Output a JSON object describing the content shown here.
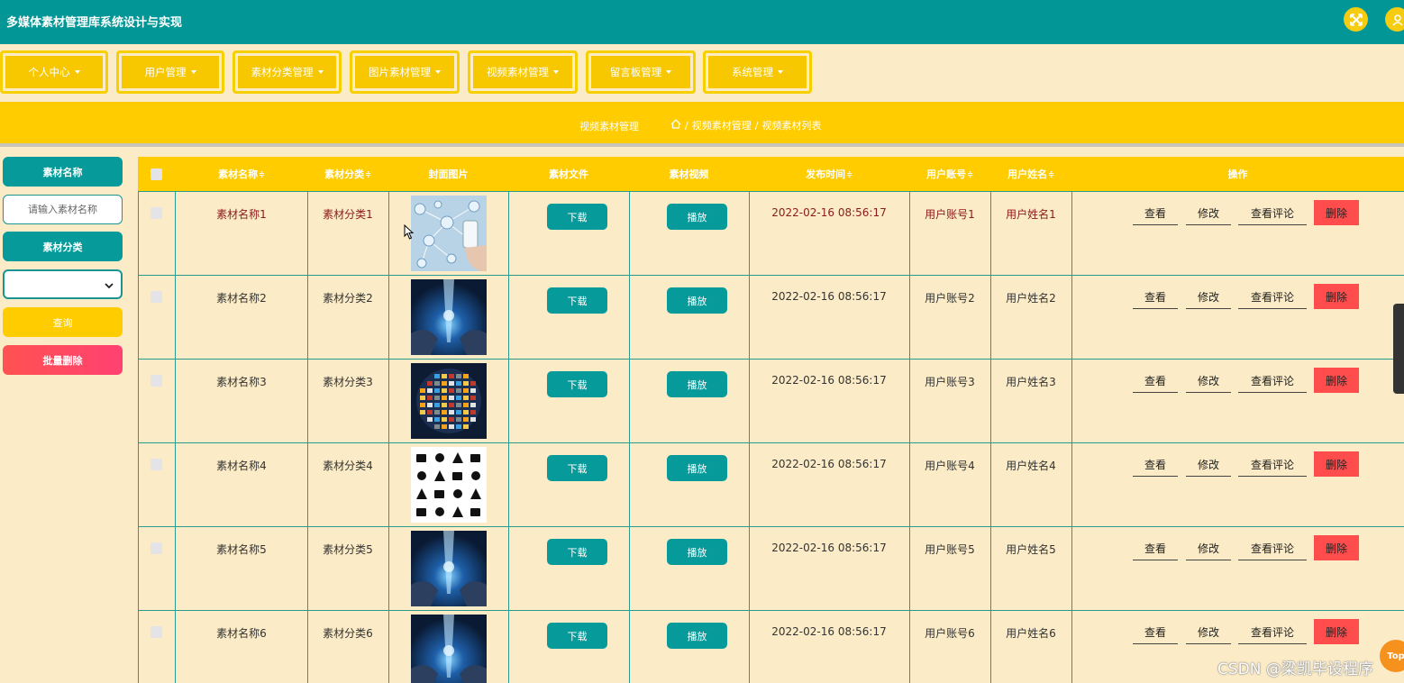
{
  "header": {
    "title": "多媒体素材管理库系统设计与实现",
    "fullscreen_icon": "fullscreen-icon",
    "user_icon": "user-icon"
  },
  "nav": {
    "items": [
      {
        "label": "个人中心"
      },
      {
        "label": "用户管理"
      },
      {
        "label": "素材分类管理"
      },
      {
        "label": "图片素材管理"
      },
      {
        "label": "视频素材管理"
      },
      {
        "label": "留言板管理"
      },
      {
        "label": "系统管理"
      }
    ]
  },
  "breadcrumb": {
    "page_title": "视频素材管理",
    "home_icon": "home-icon",
    "path_1": "视频素材管理",
    "path_2": "视频素材列表",
    "separator": "/"
  },
  "sidebar": {
    "name_label": "素材名称",
    "name_placeholder": "请输入素材名称",
    "category_label": "素材分类",
    "category_value": "",
    "query_button": "查询",
    "batch_delete_button": "批量删除"
  },
  "table": {
    "headers": {
      "name": "素材名称",
      "category": "素材分类",
      "cover": "封面图片",
      "file": "素材文件",
      "video": "素材视频",
      "published": "发布时间",
      "account": "用户账号",
      "username": "用户姓名",
      "actions": "操作"
    },
    "sort_glyph": "≑",
    "rows": [
      {
        "name": "素材名称1",
        "category": "素材分类1",
        "cover": "network-hand-phone",
        "download": "下载",
        "play": "播放",
        "published": "2022-02-16 08:56:17",
        "account": "用户账号1",
        "username": "用户姓名1",
        "view": "查看",
        "edit": "修改",
        "comments": "查看评论",
        "delete": "删除"
      },
      {
        "name": "素材名称2",
        "category": "素材分类2",
        "cover": "digital-hands",
        "download": "下载",
        "play": "播放",
        "published": "2022-02-16 08:56:17",
        "account": "用户账号2",
        "username": "用户姓名2",
        "view": "查看",
        "edit": "修改",
        "comments": "查看评论",
        "delete": "删除"
      },
      {
        "name": "素材名称3",
        "category": "素材分类3",
        "cover": "media-globe",
        "download": "下载",
        "play": "播放",
        "published": "2022-02-16 08:56:17",
        "account": "用户账号3",
        "username": "用户姓名3",
        "view": "查看",
        "edit": "修改",
        "comments": "查看评论",
        "delete": "删除"
      },
      {
        "name": "素材名称4",
        "category": "素材分类4",
        "cover": "media-icons-grid",
        "download": "下载",
        "play": "播放",
        "published": "2022-02-16 08:56:17",
        "account": "用户账号4",
        "username": "用户姓名4",
        "view": "查看",
        "edit": "修改",
        "comments": "查看评论",
        "delete": "删除"
      },
      {
        "name": "素材名称5",
        "category": "素材分类5",
        "cover": "digital-hands",
        "download": "下载",
        "play": "播放",
        "published": "2022-02-16 08:56:17",
        "account": "用户账号5",
        "username": "用户姓名5",
        "view": "查看",
        "edit": "修改",
        "comments": "查看评论",
        "delete": "删除"
      },
      {
        "name": "素材名称6",
        "category": "素材分类6",
        "cover": "digital-hands",
        "download": "下载",
        "play": "播放",
        "published": "2022-02-16 08:56:17",
        "account": "用户账号6",
        "username": "用户姓名6",
        "view": "查看",
        "edit": "修改",
        "comments": "查看评论",
        "delete": "删除"
      }
    ]
  },
  "back_to_top": "Top",
  "watermark": "CSDN @梁凯毕设程序",
  "colors": {
    "teal": "#039696",
    "yellow": "#ffcc00",
    "cream": "#fbebc6",
    "danger": "#ff4d4d",
    "first_row_text": "#8b1a1a"
  }
}
